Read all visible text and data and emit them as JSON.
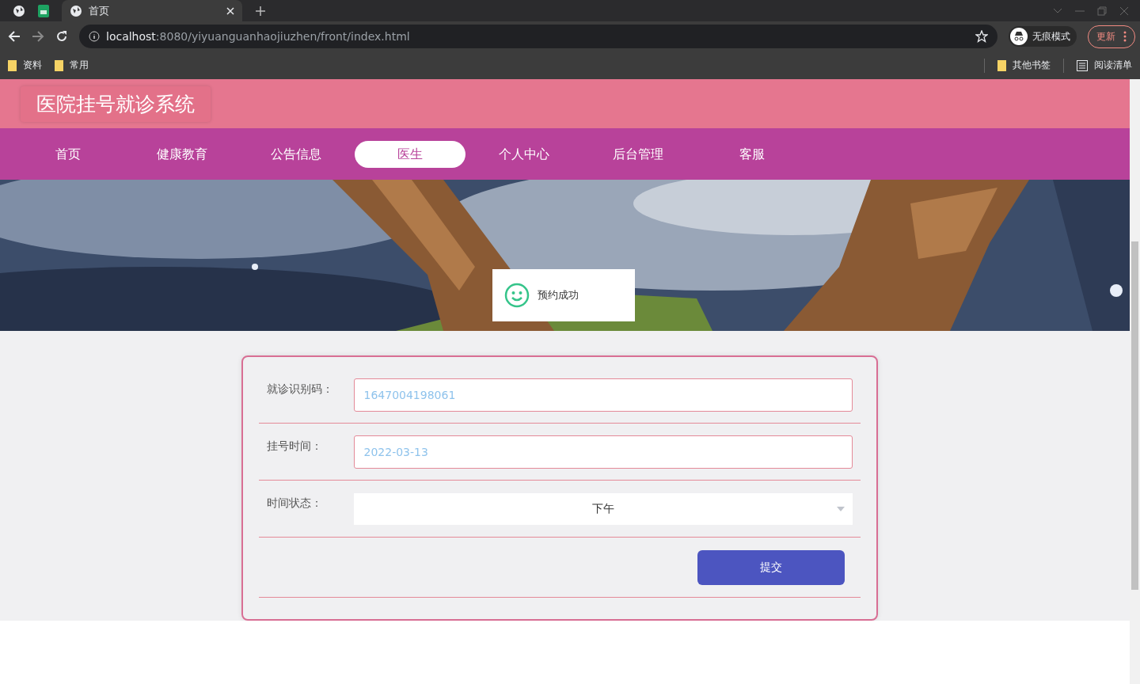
{
  "browser": {
    "tabs": [
      {
        "title": "首页",
        "selected": true
      }
    ],
    "url": {
      "host": "localhost",
      "path": ":8080/yiyuanguanhaojiuzhen/front/index.html"
    },
    "incognito": "无痕模式",
    "update": "更新",
    "bookmarks": [
      "资料",
      "常用"
    ],
    "bookmarks_right": [
      {
        "kind": "folder",
        "label": "其他书签"
      },
      {
        "kind": "list",
        "label": "阅读清单"
      }
    ]
  },
  "site": {
    "title": "医院挂号就诊系统"
  },
  "nav": [
    {
      "label": "首页",
      "selected": false
    },
    {
      "label": "健康教育",
      "selected": false
    },
    {
      "label": "公告信息",
      "selected": false
    },
    {
      "label": "医生",
      "selected": true
    },
    {
      "label": "个人中心",
      "selected": false
    },
    {
      "label": "后台管理",
      "selected": false
    },
    {
      "label": "客服",
      "selected": false
    }
  ],
  "toast": {
    "text": "预约成功"
  },
  "form": {
    "fields": [
      {
        "kind": "input",
        "label": "就诊识别码：",
        "value": "1647004198061"
      },
      {
        "kind": "input",
        "label": "挂号时间：",
        "value": "2022-03-13"
      },
      {
        "kind": "select",
        "label": "时间状态：",
        "value": "下午"
      }
    ],
    "submit": "提交"
  }
}
